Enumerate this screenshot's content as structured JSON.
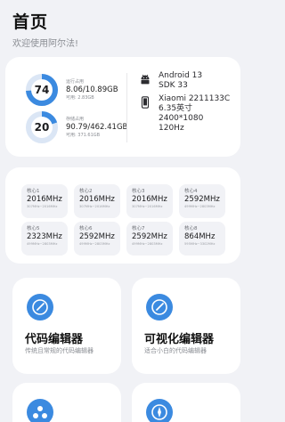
{
  "header": {
    "title": "首页",
    "subtitle": "欢迎使用阿尔法!"
  },
  "storage": [
    {
      "percent": "74",
      "label": "运行占用",
      "value": "8.06/10.89GB",
      "sub": "可用: 2.83GB",
      "ring_color": "#3b8ae0",
      "ring_fraction": 0.74
    },
    {
      "percent": "20",
      "label": "存储占用",
      "value": "90.79/462.41GB",
      "sub": "可用: 371.61GB",
      "ring_color": "#3b8ae0",
      "ring_fraction": 0.2
    }
  ],
  "system": {
    "line1": "Android 13",
    "line2": "SDK 33",
    "icon": "android-icon"
  },
  "device": {
    "model": "Xiaomi 2211133C",
    "size": "6.35英寸",
    "resolution": "2400*1080",
    "refresh": "120Hz",
    "icon": "phone-icon"
  },
  "cores": [
    {
      "name": "核心1",
      "freq": "2016MHz",
      "range": "307MHz~2016MHz"
    },
    {
      "name": "核心2",
      "freq": "2016MHz",
      "range": "307MHz~2016MHz"
    },
    {
      "name": "核心3",
      "freq": "2016MHz",
      "range": "307MHz~2016MHz"
    },
    {
      "name": "核心4",
      "freq": "2592MHz",
      "range": "499MHz~2803MHz"
    },
    {
      "name": "核心5",
      "freq": "2323MHz",
      "range": "499MHz~2803MHz"
    },
    {
      "name": "核心6",
      "freq": "2592MHz",
      "range": "499MHz~2803MHz"
    },
    {
      "name": "核心7",
      "freq": "2592MHz",
      "range": "499MHz~2803MHz"
    },
    {
      "name": "核心8",
      "freq": "864MHz",
      "range": "595MHz~3302MHz"
    }
  ],
  "features": [
    {
      "name": "代码编辑器",
      "desc": "传统且常规的代码编辑器",
      "icon": "edit-icon"
    },
    {
      "name": "可视化编辑器",
      "desc": "适合小白的代码编辑器",
      "icon": "edit-icon"
    },
    {
      "icon": "molecule-icon"
    },
    {
      "icon": "compass-icon"
    }
  ],
  "colors": {
    "accent": "#3b8ae0",
    "background": "#f1f2f6",
    "card": "#ffffff"
  }
}
